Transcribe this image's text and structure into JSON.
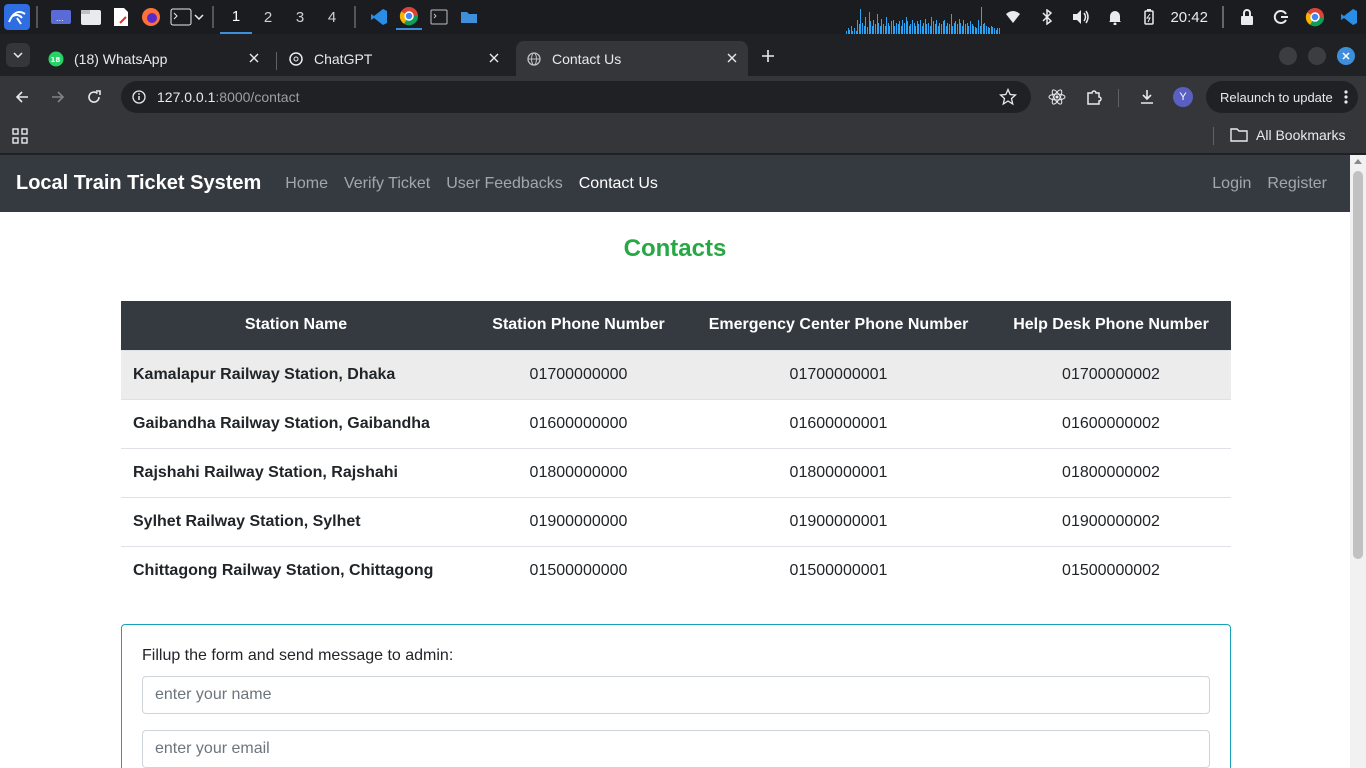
{
  "os": {
    "workspaces": [
      "1",
      "2",
      "3",
      "4"
    ],
    "active_workspace": "1",
    "clock": "20:42",
    "activity_levels": [
      0.1,
      0.2,
      0.15,
      0.3,
      0.1,
      0.2,
      0.12,
      0.5,
      0.35,
      0.9,
      0.4,
      0.3,
      0.6,
      0.25,
      0.8,
      0.45,
      0.3,
      0.5,
      0.35,
      0.7,
      0.4,
      0.3,
      0.55,
      0.35,
      0.3,
      0.6,
      0.4,
      0.3,
      0.45,
      0.5,
      0.3,
      0.4,
      0.35,
      0.45,
      0.3,
      0.5,
      0.4,
      0.6,
      0.45,
      0.3,
      0.35,
      0.5,
      0.4,
      0.3,
      0.45,
      0.35,
      0.5,
      0.3,
      0.4,
      0.55,
      0.35,
      0.4,
      0.3,
      0.6,
      0.45,
      0.35,
      0.5,
      0.3,
      0.4,
      0.35,
      0.45,
      0.5,
      0.3,
      0.4,
      0.35,
      0.7,
      0.3,
      0.4,
      0.45,
      0.35,
      0.55,
      0.4,
      0.3,
      0.5,
      0.35,
      0.4,
      0.3,
      0.45,
      0.35,
      0.3,
      0.25,
      0.2,
      0.5,
      0.3,
      0.95,
      0.35,
      0.4,
      0.3,
      0.25,
      0.2,
      0.3,
      0.25,
      0.2,
      0.15,
      0.2,
      0.2
    ]
  },
  "browser": {
    "tabs": [
      {
        "title": "(18) WhatsApp",
        "icon": "whatsapp-icon",
        "active": false
      },
      {
        "title": "ChatGPT",
        "icon": "chatgpt-icon",
        "active": false
      },
      {
        "title": "Contact Us",
        "icon": "globe-icon",
        "active": true
      }
    ],
    "url_host": "127.0.0.1",
    "url_path": ":8000/contact",
    "profile_initial": "Y",
    "relaunch_label": "Relaunch to update",
    "all_bookmarks_label": "All Bookmarks"
  },
  "site": {
    "brand": "Local Train Ticket System",
    "nav": [
      "Home",
      "Verify Ticket",
      "User Feedbacks",
      "Contact Us"
    ],
    "active_nav": "Contact Us",
    "auth": [
      "Login",
      "Register"
    ],
    "page_title": "Contacts",
    "title_color": "#28a745",
    "table": {
      "headers": [
        "Station Name",
        "Station Phone Number",
        "Emergency Center Phone Number",
        "Help Desk Phone Number"
      ],
      "rows": [
        [
          "Kamalapur Railway Station, Dhaka",
          "01700000000",
          "01700000001",
          "01700000002"
        ],
        [
          "Gaibandha Railway Station, Gaibandha",
          "01600000000",
          "01600000001",
          "01600000002"
        ],
        [
          "Rajshahi Railway Station, Rajshahi",
          "01800000000",
          "01800000001",
          "01800000002"
        ],
        [
          "Sylhet Railway Station, Sylhet",
          "01900000000",
          "01900000001",
          "01900000002"
        ],
        [
          "Chittagong Railway Station, Chittagong",
          "01500000000",
          "01500000001",
          "01500000002"
        ]
      ]
    },
    "form": {
      "label": "Fillup the form and send message to admin:",
      "name_placeholder": "enter your name",
      "email_placeholder": "enter your email"
    }
  }
}
